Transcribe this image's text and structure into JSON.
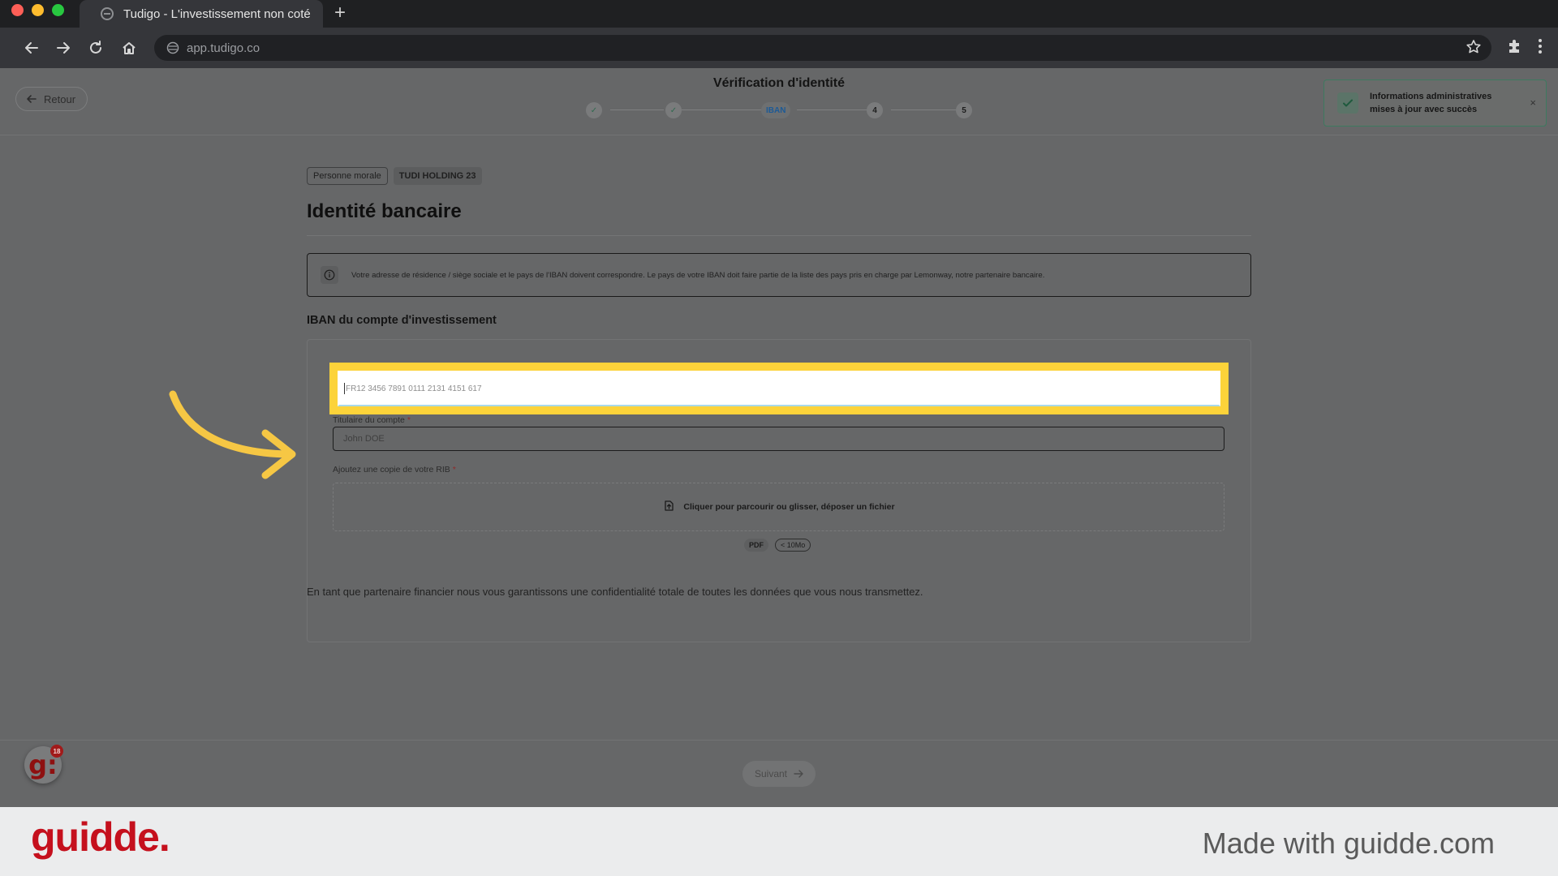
{
  "browser": {
    "tab_title": "Tudigo - L'investissement non coté",
    "new_tab_symbol": "+",
    "url": "app.tudigo.co"
  },
  "header": {
    "back_label": "Retour",
    "stepper_title": "Vérification d'identité",
    "steps": [
      {
        "label": "✓",
        "state": "done"
      },
      {
        "label": "✓",
        "state": "done"
      },
      {
        "label": "IBAN",
        "state": "active"
      },
      {
        "label": "4",
        "state": "todo"
      },
      {
        "label": "5",
        "state": "todo"
      }
    ]
  },
  "toast": {
    "message": "Informations administratives mises à jour avec succès",
    "close_symbol": "×"
  },
  "main": {
    "badge_type": "Personne morale",
    "badge_entity": "TUDI HOLDING 23",
    "title": "Identité bancaire",
    "info_text": "Votre adresse de résidence / siège sociale et le pays de l'IBAN doivent correspondre. Le pays de votre IBAN doit faire partie de la liste des pays pris en charge par Lemonway, notre partenaire bancaire.",
    "iban_section_label": "IBAN du compte d'investissement",
    "iban_placeholder": "FR12 3456 7891 0111 2131 4151 617",
    "holder_label": "Titulaire du compte",
    "holder_placeholder": "John DOE",
    "required_mark": "*",
    "rib_label": "Ajoutez une copie de votre RIB",
    "dropzone_text": "Cliquer pour parcourir ou glisser, déposer un fichier",
    "file_type": "PDF",
    "file_size_limit": "< 10Mo",
    "confidential_text": "En tant que partenaire financier nous vous garantissons une confidentialité totale de toutes les données que vous nous transmettez."
  },
  "footer": {
    "next_label": "Suivant",
    "guidde_bubble_letter": "g:",
    "guidde_badge_count": "18"
  },
  "branding": {
    "logo": "guidde.",
    "made_with": "Made with guidde.com"
  },
  "colors": {
    "highlight": "#fcd33a",
    "arrow": "#f6c744",
    "brand_red": "#c5101d",
    "success_green": "#3d7a5f"
  }
}
